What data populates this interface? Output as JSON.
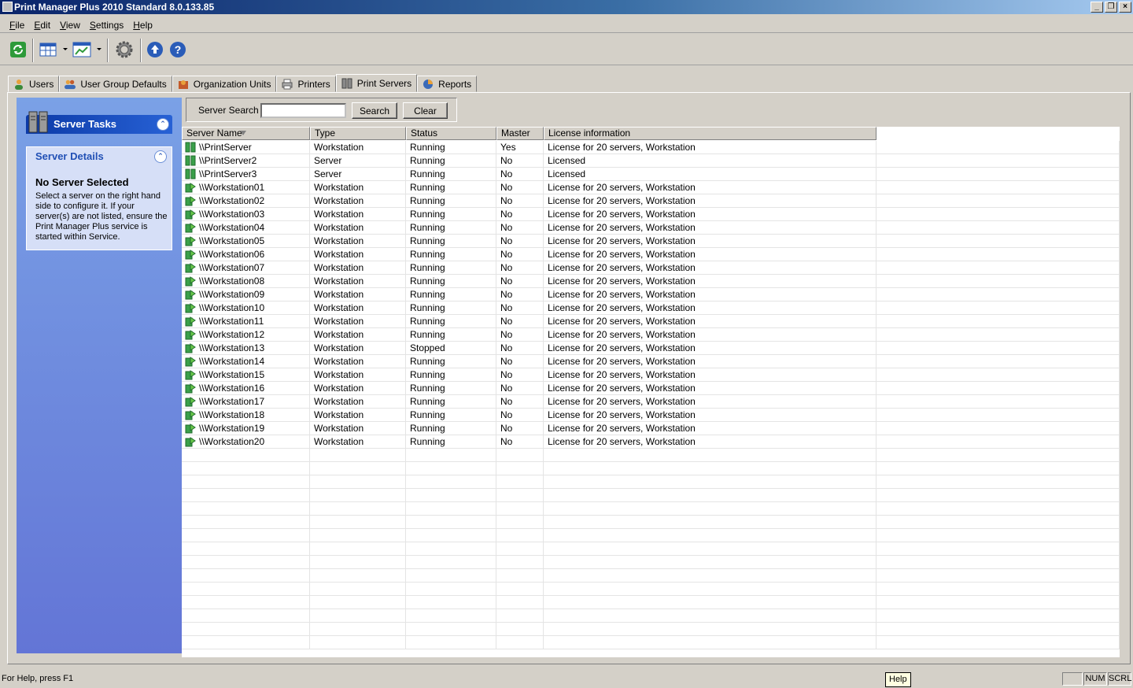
{
  "window": {
    "title": "Print Manager Plus 2010 Standard 8.0.133.85"
  },
  "menu": [
    {
      "label": "File",
      "underline": "F",
      "rest": "ile"
    },
    {
      "label": "Edit",
      "underline": "E",
      "rest": "dit"
    },
    {
      "label": "View",
      "underline": "V",
      "rest": "iew"
    },
    {
      "label": "Settings",
      "underline": "S",
      "rest": "ettings"
    },
    {
      "label": "Help",
      "underline": "H",
      "rest": "elp"
    }
  ],
  "toolbar": {
    "icons": [
      "refresh-icon",
      "view-grid-icon",
      "report-view-icon",
      "settings-gear-icon",
      "upload-icon",
      "help-icon"
    ]
  },
  "tabs": [
    {
      "label": "Users",
      "icon": "user-icon",
      "active": false
    },
    {
      "label": "User Group Defaults",
      "icon": "user-group-icon",
      "active": false
    },
    {
      "label": "Organization Units",
      "icon": "org-unit-icon",
      "active": false
    },
    {
      "label": "Printers",
      "icon": "printer-icon",
      "active": false
    },
    {
      "label": "Print Servers",
      "icon": "server-icon",
      "active": true
    },
    {
      "label": "Reports",
      "icon": "report-icon",
      "active": false
    }
  ],
  "sidebar": {
    "tasks_title": "Server Tasks",
    "details_title": "Server Details",
    "details_heading": "No Server Selected",
    "details_text": "Select a server on the right hand side to configure it.  If your server(s) are not listed, ensure the Print Manager Plus service is started within Service."
  },
  "search": {
    "label": "Server Search",
    "value": "",
    "search_button": "Search",
    "clear_button": "Clear"
  },
  "table": {
    "columns": [
      "Server Name",
      "Type",
      "Status",
      "Master",
      "License information"
    ],
    "rows": [
      [
        "\\\\PrintServer",
        "Workstation",
        "Running",
        "Yes",
        "License for 20 servers, Workstation"
      ],
      [
        "\\\\PrintServer2",
        "Server",
        "Running",
        "No",
        "Licensed"
      ],
      [
        "\\\\PrintServer3",
        "Server",
        "Running",
        "No",
        "Licensed"
      ],
      [
        "\\\\Workstation01",
        "Workstation",
        "Running",
        "No",
        "License for 20 servers, Workstation"
      ],
      [
        "\\\\Workstation02",
        "Workstation",
        "Running",
        "No",
        "License for 20 servers, Workstation"
      ],
      [
        "\\\\Workstation03",
        "Workstation",
        "Running",
        "No",
        "License for 20 servers, Workstation"
      ],
      [
        "\\\\Workstation04",
        "Workstation",
        "Running",
        "No",
        "License for 20 servers, Workstation"
      ],
      [
        "\\\\Workstation05",
        "Workstation",
        "Running",
        "No",
        "License for 20 servers, Workstation"
      ],
      [
        "\\\\Workstation06",
        "Workstation",
        "Running",
        "No",
        "License for 20 servers, Workstation"
      ],
      [
        "\\\\Workstation07",
        "Workstation",
        "Running",
        "No",
        "License for 20 servers, Workstation"
      ],
      [
        "\\\\Workstation08",
        "Workstation",
        "Running",
        "No",
        "License for 20 servers, Workstation"
      ],
      [
        "\\\\Workstation09",
        "Workstation",
        "Running",
        "No",
        "License for 20 servers, Workstation"
      ],
      [
        "\\\\Workstation10",
        "Workstation",
        "Running",
        "No",
        "License for 20 servers, Workstation"
      ],
      [
        "\\\\Workstation11",
        "Workstation",
        "Running",
        "No",
        "License for 20 servers, Workstation"
      ],
      [
        "\\\\Workstation12",
        "Workstation",
        "Running",
        "No",
        "License for 20 servers, Workstation"
      ],
      [
        "\\\\Workstation13",
        "Workstation",
        "Stopped",
        "No",
        "License for 20 servers, Workstation"
      ],
      [
        "\\\\Workstation14",
        "Workstation",
        "Running",
        "No",
        "License for 20 servers, Workstation"
      ],
      [
        "\\\\Workstation15",
        "Workstation",
        "Running",
        "No",
        "License for 20 servers, Workstation"
      ],
      [
        "\\\\Workstation16",
        "Workstation",
        "Running",
        "No",
        "License for 20 servers, Workstation"
      ],
      [
        "\\\\Workstation17",
        "Workstation",
        "Running",
        "No",
        "License for 20 servers, Workstation"
      ],
      [
        "\\\\Workstation18",
        "Workstation",
        "Running",
        "No",
        "License for 20 servers, Workstation"
      ],
      [
        "\\\\Workstation19",
        "Workstation",
        "Running",
        "No",
        "License for 20 servers, Workstation"
      ],
      [
        "\\\\Workstation20",
        "Workstation",
        "Running",
        "No",
        "License for 20 servers, Workstation"
      ]
    ],
    "row_icons": [
      "server-tower-icon",
      "server-tower-icon",
      "server-tower-icon",
      "workstation-arrow-icon"
    ]
  },
  "statusbar": {
    "message": "For Help, press F1",
    "tooltip": "Help",
    "num": "NUM",
    "scrl": "SCRL"
  }
}
